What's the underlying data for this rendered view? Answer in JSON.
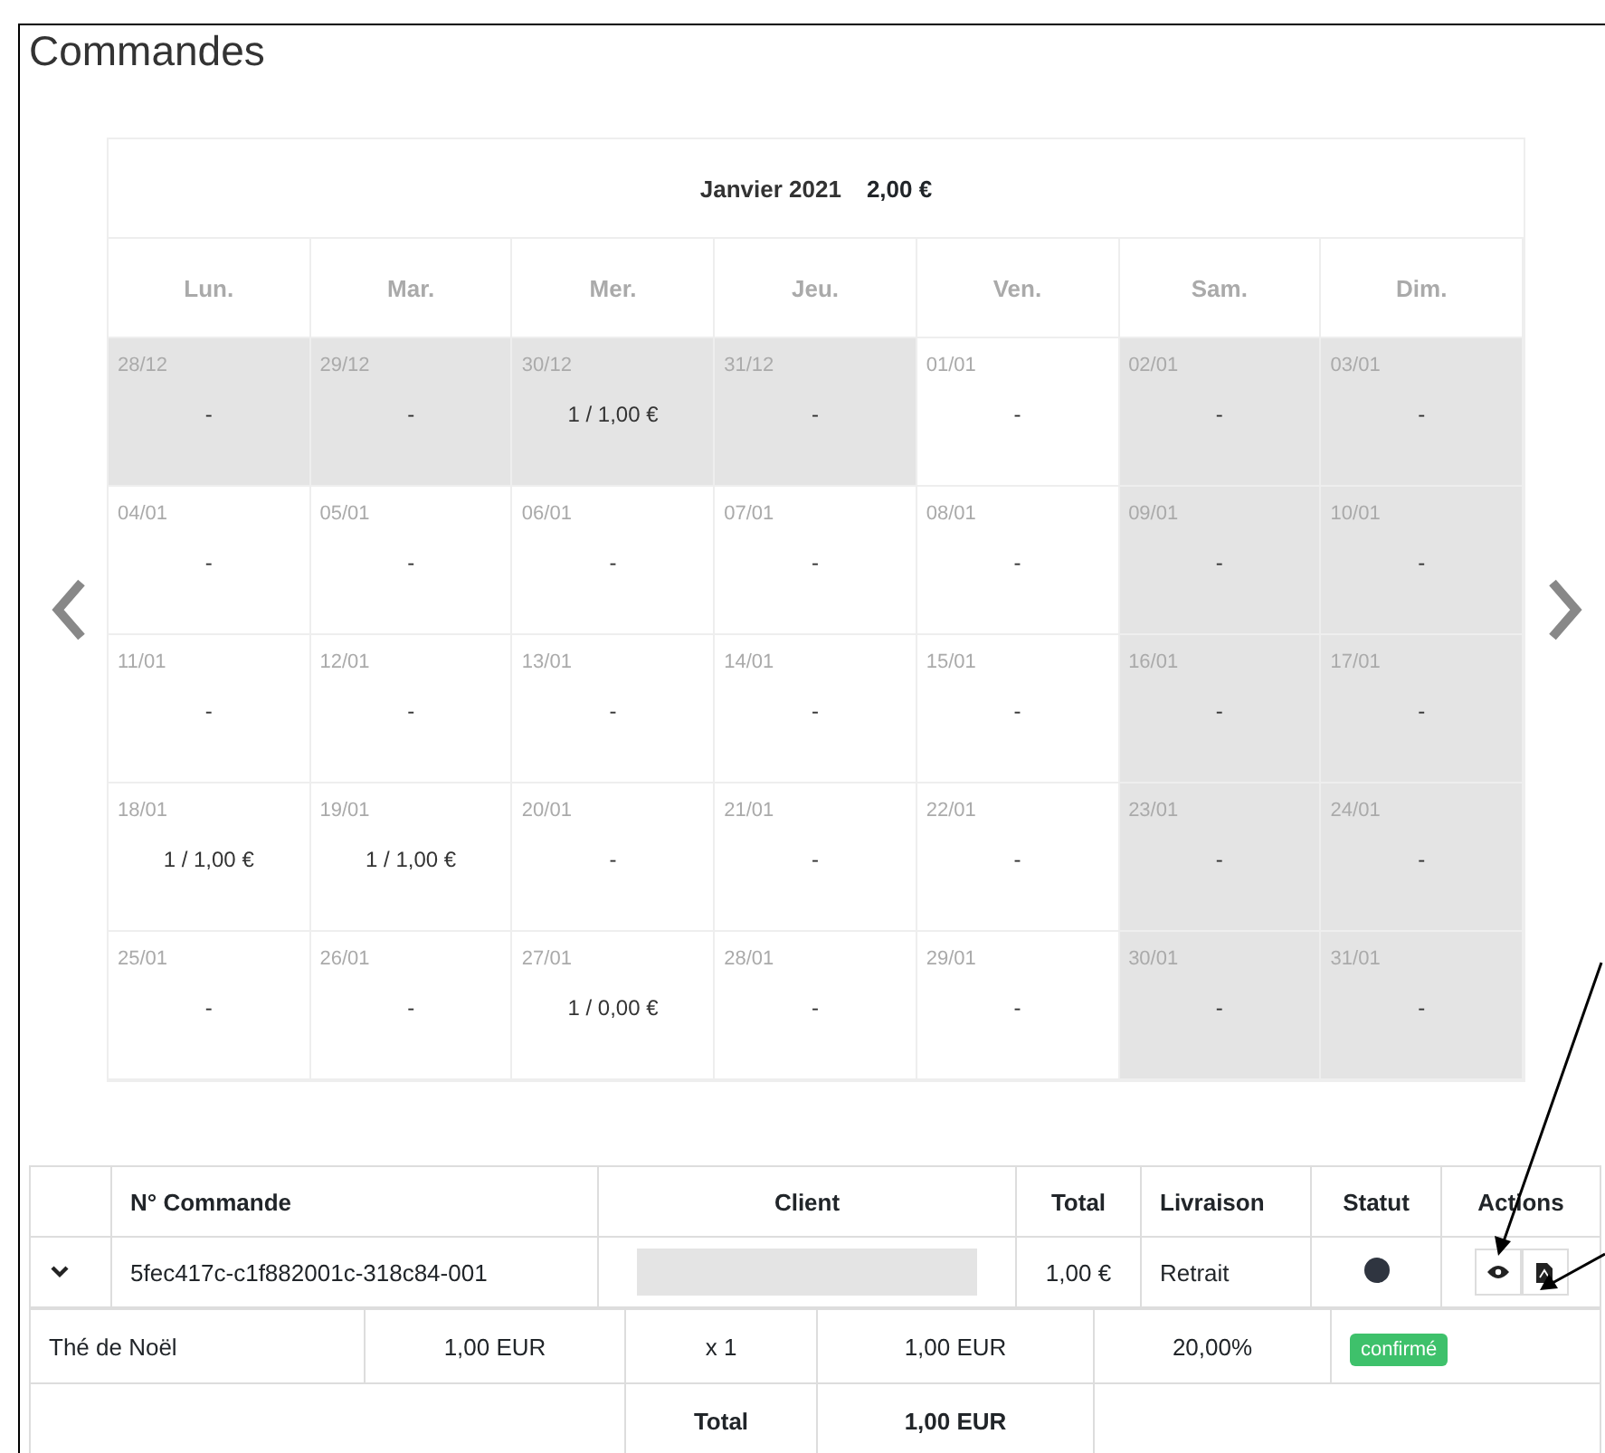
{
  "title": "Commandes",
  "calendar": {
    "month": "Janvier 2021",
    "month_total": "2,00 €",
    "weekdays": [
      "Lun.",
      "Mar.",
      "Mer.",
      "Jeu.",
      "Ven.",
      "Sam.",
      "Dim."
    ],
    "weeks": [
      [
        {
          "date": "28/12",
          "value": "-",
          "shaded": true
        },
        {
          "date": "29/12",
          "value": "-",
          "shaded": true
        },
        {
          "date": "30/12",
          "value": "1 / 1,00 €",
          "shaded": true
        },
        {
          "date": "31/12",
          "value": "-",
          "shaded": true
        },
        {
          "date": "01/01",
          "value": "-",
          "shaded": false
        },
        {
          "date": "02/01",
          "value": "-",
          "shaded": true
        },
        {
          "date": "03/01",
          "value": "-",
          "shaded": true
        }
      ],
      [
        {
          "date": "04/01",
          "value": "-",
          "shaded": false
        },
        {
          "date": "05/01",
          "value": "-",
          "shaded": false
        },
        {
          "date": "06/01",
          "value": "-",
          "shaded": false
        },
        {
          "date": "07/01",
          "value": "-",
          "shaded": false
        },
        {
          "date": "08/01",
          "value": "-",
          "shaded": false
        },
        {
          "date": "09/01",
          "value": "-",
          "shaded": true
        },
        {
          "date": "10/01",
          "value": "-",
          "shaded": true
        }
      ],
      [
        {
          "date": "11/01",
          "value": "-",
          "shaded": false
        },
        {
          "date": "12/01",
          "value": "-",
          "shaded": false
        },
        {
          "date": "13/01",
          "value": "-",
          "shaded": false
        },
        {
          "date": "14/01",
          "value": "-",
          "shaded": false
        },
        {
          "date": "15/01",
          "value": "-",
          "shaded": false
        },
        {
          "date": "16/01",
          "value": "-",
          "shaded": true
        },
        {
          "date": "17/01",
          "value": "-",
          "shaded": true
        }
      ],
      [
        {
          "date": "18/01",
          "value": "1 / 1,00 €",
          "shaded": false
        },
        {
          "date": "19/01",
          "value": "1 / 1,00 €",
          "shaded": false
        },
        {
          "date": "20/01",
          "value": "-",
          "shaded": false
        },
        {
          "date": "21/01",
          "value": "-",
          "shaded": false
        },
        {
          "date": "22/01",
          "value": "-",
          "shaded": false
        },
        {
          "date": "23/01",
          "value": "-",
          "shaded": true
        },
        {
          "date": "24/01",
          "value": "-",
          "shaded": true
        }
      ],
      [
        {
          "date": "25/01",
          "value": "-",
          "shaded": false
        },
        {
          "date": "26/01",
          "value": "-",
          "shaded": false
        },
        {
          "date": "27/01",
          "value": "1 / 0,00 €",
          "shaded": false
        },
        {
          "date": "28/01",
          "value": "-",
          "shaded": false
        },
        {
          "date": "29/01",
          "value": "-",
          "shaded": false
        },
        {
          "date": "30/01",
          "value": "-",
          "shaded": true
        },
        {
          "date": "31/01",
          "value": "-",
          "shaded": true
        }
      ]
    ]
  },
  "orders": {
    "columns": [
      "N° Commande",
      "Client",
      "Total",
      "Livraison",
      "Statut",
      "Actions"
    ],
    "rows": [
      {
        "expanded": true,
        "number": "5fec417c-c1f882001c-318c84-001",
        "total": "1,00 €",
        "delivery": "Retrait",
        "status_filled": true,
        "items": [
          {
            "product": "Thé de Noël",
            "unit_price": "1,00 EUR",
            "quantity": "x 1",
            "amount": "1,00 EUR",
            "vat": "20,00%",
            "badge": "confirmé"
          }
        ],
        "total_label": "Total",
        "total_value": "1,00 EUR"
      }
    ]
  }
}
